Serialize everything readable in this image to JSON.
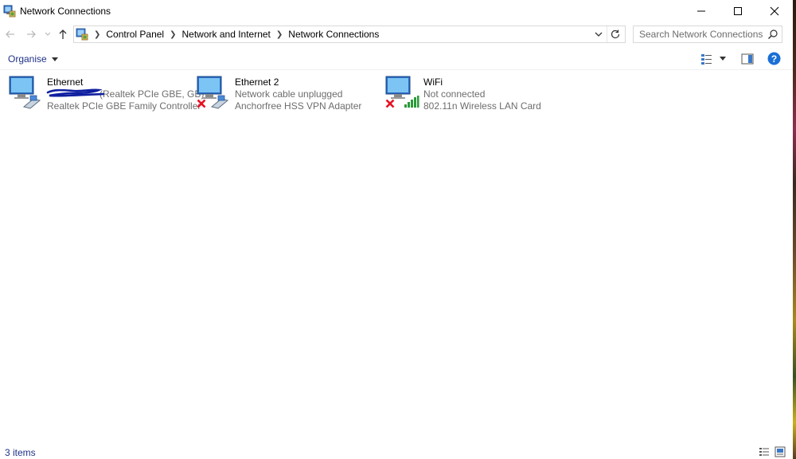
{
  "window": {
    "title": "Network Connections"
  },
  "address": {
    "crumbs": [
      "Control Panel",
      "Network and Internet",
      "Network Connections"
    ]
  },
  "search": {
    "placeholder": "Search Network Connections"
  },
  "toolbar": {
    "organise_label": "Organise"
  },
  "connections": [
    {
      "name": "Ethernet",
      "status": "(Realtek PCIe GBE, GB)",
      "adapter": "Realtek PCIe GBE Family Controller"
    },
    {
      "name": "Ethernet 2",
      "status": "Network cable unplugged",
      "adapter": "Anchorfree HSS VPN Adapter"
    },
    {
      "name": "WiFi",
      "status": "Not connected",
      "adapter": "802.11n Wireless LAN Card"
    }
  ],
  "statusbar": {
    "count": "3 items"
  },
  "colors": {
    "link_blue": "#1e3287",
    "help_blue": "#1a6fd6",
    "error_red": "#e81123",
    "signal_green": "#2a9a3a"
  },
  "icons": {
    "title": "network-connections-icon",
    "search": "search-icon",
    "help": "help-icon",
    "disconnected": "red-x-icon"
  }
}
